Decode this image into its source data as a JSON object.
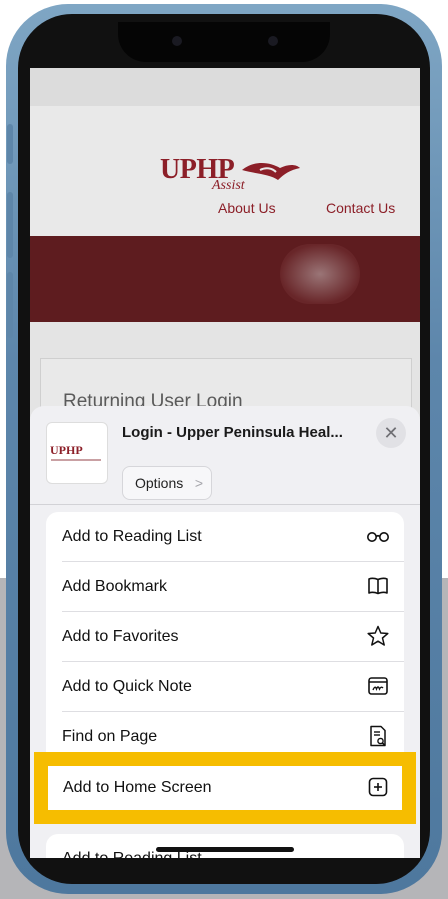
{
  "website": {
    "logo_text": "UPHP",
    "logo_subtext": "Assist",
    "nav": {
      "about": "About Us",
      "contact": "Contact Us"
    },
    "login_heading": "Returning User Login"
  },
  "share_sheet": {
    "page_thumb_logo": "UPHP",
    "page_title": "Login - Upper Peninsula Heal...",
    "close_symbol": "✕",
    "options_label": "Options",
    "options_chevron": ">",
    "actions": [
      {
        "label": "Add to Reading List",
        "icon": "glasses-icon"
      },
      {
        "label": "Add Bookmark",
        "icon": "book-icon"
      },
      {
        "label": "Add to Favorites",
        "icon": "star-icon"
      },
      {
        "label": "Add to Quick Note",
        "icon": "quick-note-icon"
      },
      {
        "label": "Find on Page",
        "icon": "find-on-page-icon"
      },
      {
        "label": "Add to Home Screen",
        "icon": "add-square-icon",
        "highlighted": true
      }
    ],
    "next_section_label": "Add to Reading List"
  },
  "colors": {
    "brand": "#8c1f28",
    "highlight": "#f6bd00"
  }
}
